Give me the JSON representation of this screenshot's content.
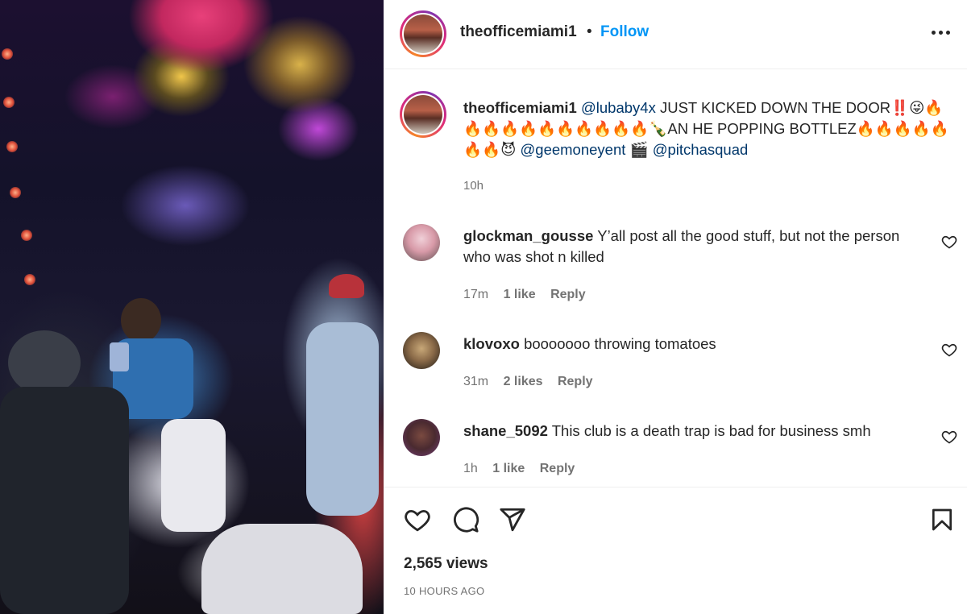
{
  "post": {
    "author": "theofficemiami1",
    "separator": "•",
    "follow_label": "Follow",
    "more_icon": "more-options-icon"
  },
  "caption": {
    "username": "theofficemiami1",
    "mention1": "@lubaby4x",
    "line1_text": "JUST KICKED DOWN THE DOOR‼️😜🔥",
    "line2_text": "🔥🔥🔥🔥🔥🔥🔥🔥🔥🔥🍾AN HE POPPING BOTTLEZ🔥🔥🔥🔥🔥",
    "line3_emoji": "🔥🔥😈",
    "mention2": "@geemoneyent",
    "clapper": "🎬",
    "mention3": "@pitchasquad",
    "time": "10h"
  },
  "comments": [
    {
      "username": "glockman_gousse",
      "text": "Y’all post all the good stuff, but not the person who was shot n killed",
      "time": "17m",
      "likes": "1 like",
      "reply": "Reply"
    },
    {
      "username": "klovoxo",
      "text": "booooooo throwing tomatoes",
      "time": "31m",
      "likes": "2 likes",
      "reply": "Reply"
    },
    {
      "username": "shane_5092",
      "text": "This club is a death trap is bad for business smh",
      "time": "1h",
      "likes": "1 like",
      "reply": "Reply"
    }
  ],
  "stats": {
    "views": "2,565 views",
    "posted": "10 HOURS AGO"
  },
  "colors": {
    "link": "#0095f6",
    "mention": "#00376b",
    "secondary_text": "#737373",
    "primary_text": "#262626"
  }
}
